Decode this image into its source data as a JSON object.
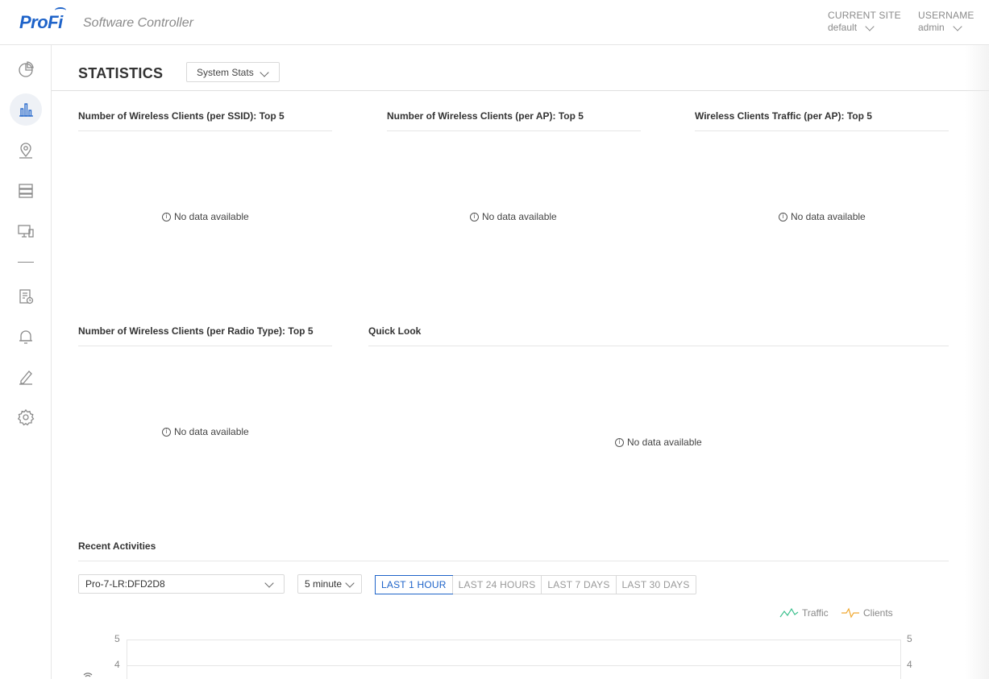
{
  "brand": {
    "logo": "ProFi",
    "subtitle": "Software Controller"
  },
  "header": {
    "site": {
      "label": "CURRENT SITE",
      "value": "default"
    },
    "user": {
      "label": "USERNAME",
      "value": "admin"
    }
  },
  "sidebar": {
    "items": [
      {
        "icon": "dashboard-pie-icon"
      },
      {
        "icon": "statistics-bar-icon",
        "active": true
      },
      {
        "icon": "map-location-icon"
      },
      {
        "icon": "devices-list-icon"
      },
      {
        "icon": "clients-monitor-icon"
      },
      {
        "icon": "log-schedule-icon"
      },
      {
        "icon": "alert-bell-icon"
      },
      {
        "icon": "edit-pencil-icon"
      },
      {
        "icon": "settings-gear-icon"
      }
    ]
  },
  "page": {
    "title": "STATISTICS",
    "view_select": "System Stats"
  },
  "panels": {
    "ssid": {
      "title": "Number of Wireless Clients (per SSID): Top 5",
      "empty": "No data available"
    },
    "ap": {
      "title": "Number of Wireless Clients (per AP): Top 5",
      "empty": "No data available"
    },
    "traffic": {
      "title": "Wireless Clients Traffic (per AP): Top 5",
      "empty": "No data available"
    },
    "radio": {
      "title": "Number of Wireless Clients (per Radio Type): Top 5",
      "empty": "No data available"
    },
    "quick": {
      "title": "Quick Look",
      "empty": "No data available"
    }
  },
  "activities": {
    "title": "Recent Activities",
    "device": "Pro-7-LR:DFD2D8",
    "interval": "5 minute",
    "ranges": [
      "LAST 1 HOUR",
      "LAST 24 HOURS",
      "LAST 7 DAYS",
      "LAST 30 DAYS"
    ],
    "active_range": "LAST 1 HOUR",
    "legend": [
      {
        "name": "Traffic",
        "color": "#3cc08e"
      },
      {
        "name": "Clients",
        "color": "#f0a830"
      }
    ],
    "y_ticks": [
      "5",
      "4"
    ]
  }
}
